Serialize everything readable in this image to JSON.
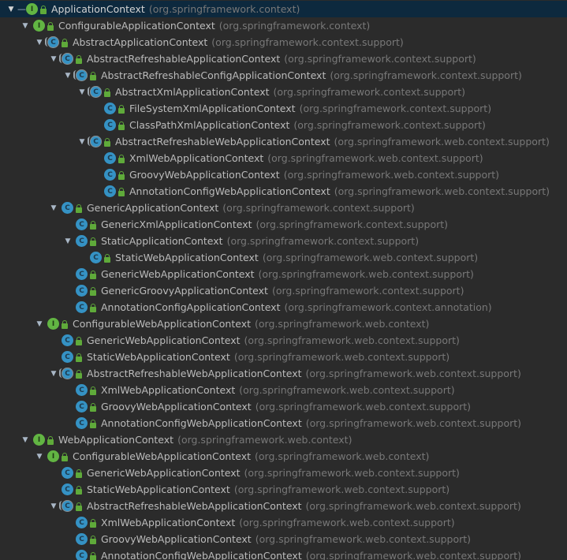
{
  "tree": {
    "rows": [
      {
        "depth": 0,
        "expanded": true,
        "kind": "interface",
        "name": "ApplicationContext",
        "pkg": "(org.springframework.context)",
        "selected": true
      },
      {
        "depth": 1,
        "expanded": true,
        "kind": "interface",
        "name": "ConfigurableApplicationContext",
        "pkg": "(org.springframework.context)"
      },
      {
        "depth": 2,
        "expanded": true,
        "kind": "abstract",
        "name": "AbstractApplicationContext",
        "pkg": "(org.springframework.context.support)"
      },
      {
        "depth": 3,
        "expanded": true,
        "kind": "abstract",
        "name": "AbstractRefreshableApplicationContext",
        "pkg": "(org.springframework.context.support)"
      },
      {
        "depth": 4,
        "expanded": true,
        "kind": "abstract",
        "name": "AbstractRefreshableConfigApplicationContext",
        "pkg": "(org.springframework.context.support)"
      },
      {
        "depth": 5,
        "expanded": true,
        "kind": "abstract",
        "name": "AbstractXmlApplicationContext",
        "pkg": "(org.springframework.context.support)"
      },
      {
        "depth": 6,
        "expanded": false,
        "kind": "class",
        "name": "FileSystemXmlApplicationContext",
        "pkg": "(org.springframework.context.support)"
      },
      {
        "depth": 6,
        "expanded": false,
        "kind": "class",
        "name": "ClassPathXmlApplicationContext",
        "pkg": "(org.springframework.context.support)"
      },
      {
        "depth": 5,
        "expanded": true,
        "kind": "abstract",
        "name": "AbstractRefreshableWebApplicationContext",
        "pkg": "(org.springframework.web.context.support)"
      },
      {
        "depth": 6,
        "expanded": false,
        "kind": "class",
        "name": "XmlWebApplicationContext",
        "pkg": "(org.springframework.web.context.support)"
      },
      {
        "depth": 6,
        "expanded": false,
        "kind": "class",
        "name": "GroovyWebApplicationContext",
        "pkg": "(org.springframework.web.context.support)"
      },
      {
        "depth": 6,
        "expanded": false,
        "kind": "class",
        "name": "AnnotationConfigWebApplicationContext",
        "pkg": "(org.springframework.web.context.support)"
      },
      {
        "depth": 3,
        "expanded": true,
        "kind": "class",
        "name": "GenericApplicationContext",
        "pkg": "(org.springframework.context.support)"
      },
      {
        "depth": 4,
        "expanded": false,
        "kind": "class",
        "name": "GenericXmlApplicationContext",
        "pkg": "(org.springframework.context.support)"
      },
      {
        "depth": 4,
        "expanded": true,
        "kind": "class",
        "name": "StaticApplicationContext",
        "pkg": "(org.springframework.context.support)"
      },
      {
        "depth": 5,
        "expanded": false,
        "kind": "class",
        "name": "StaticWebApplicationContext",
        "pkg": "(org.springframework.web.context.support)"
      },
      {
        "depth": 4,
        "expanded": false,
        "kind": "class",
        "name": "GenericWebApplicationContext",
        "pkg": "(org.springframework.web.context.support)"
      },
      {
        "depth": 4,
        "expanded": false,
        "kind": "class",
        "name": "GenericGroovyApplicationContext",
        "pkg": "(org.springframework.context.support)"
      },
      {
        "depth": 4,
        "expanded": false,
        "kind": "class",
        "name": "AnnotationConfigApplicationContext",
        "pkg": "(org.springframework.context.annotation)"
      },
      {
        "depth": 2,
        "expanded": true,
        "kind": "interface",
        "name": "ConfigurableWebApplicationContext",
        "pkg": "(org.springframework.web.context)"
      },
      {
        "depth": 3,
        "expanded": false,
        "kind": "class",
        "name": "GenericWebApplicationContext",
        "pkg": "(org.springframework.web.context.support)"
      },
      {
        "depth": 3,
        "expanded": false,
        "kind": "class",
        "name": "StaticWebApplicationContext",
        "pkg": "(org.springframework.web.context.support)"
      },
      {
        "depth": 3,
        "expanded": true,
        "kind": "abstract",
        "name": "AbstractRefreshableWebApplicationContext",
        "pkg": "(org.springframework.web.context.support)"
      },
      {
        "depth": 4,
        "expanded": false,
        "kind": "class",
        "name": "XmlWebApplicationContext",
        "pkg": "(org.springframework.web.context.support)"
      },
      {
        "depth": 4,
        "expanded": false,
        "kind": "class",
        "name": "GroovyWebApplicationContext",
        "pkg": "(org.springframework.web.context.support)"
      },
      {
        "depth": 4,
        "expanded": false,
        "kind": "class",
        "name": "AnnotationConfigWebApplicationContext",
        "pkg": "(org.springframework.web.context.support)"
      },
      {
        "depth": 1,
        "expanded": true,
        "kind": "interface",
        "name": "WebApplicationContext",
        "pkg": "(org.springframework.web.context)"
      },
      {
        "depth": 2,
        "expanded": true,
        "kind": "interface",
        "name": "ConfigurableWebApplicationContext",
        "pkg": "(org.springframework.web.context)"
      },
      {
        "depth": 3,
        "expanded": false,
        "kind": "class",
        "name": "GenericWebApplicationContext",
        "pkg": "(org.springframework.web.context.support)"
      },
      {
        "depth": 3,
        "expanded": false,
        "kind": "class",
        "name": "StaticWebApplicationContext",
        "pkg": "(org.springframework.web.context.support)"
      },
      {
        "depth": 3,
        "expanded": true,
        "kind": "abstract",
        "name": "AbstractRefreshableWebApplicationContext",
        "pkg": "(org.springframework.web.context.support)"
      },
      {
        "depth": 4,
        "expanded": false,
        "kind": "class",
        "name": "XmlWebApplicationContext",
        "pkg": "(org.springframework.web.context.support)"
      },
      {
        "depth": 4,
        "expanded": false,
        "kind": "class",
        "name": "GroovyWebApplicationContext",
        "pkg": "(org.springframework.web.context.support)"
      },
      {
        "depth": 4,
        "expanded": false,
        "kind": "class",
        "name": "AnnotationConfigWebApplicationContext",
        "pkg": "(org.springframework.web.context.support)"
      }
    ]
  },
  "icons": {
    "interface": {
      "letter": "I",
      "semantic": "interface-icon",
      "color": "#62b543"
    },
    "class": {
      "letter": "C",
      "semantic": "class-icon",
      "color": "#3592c4"
    },
    "abstract": {
      "letter": "C",
      "semantic": "abstract-class-icon",
      "color": "#3592c4"
    },
    "expanded_arrow": "▼",
    "collapsed_arrow": "▶"
  },
  "colors": {
    "background": "#2b2b2b",
    "selection": "#0d293e",
    "name_text": "#bbbbbb",
    "package_text": "#787878"
  }
}
